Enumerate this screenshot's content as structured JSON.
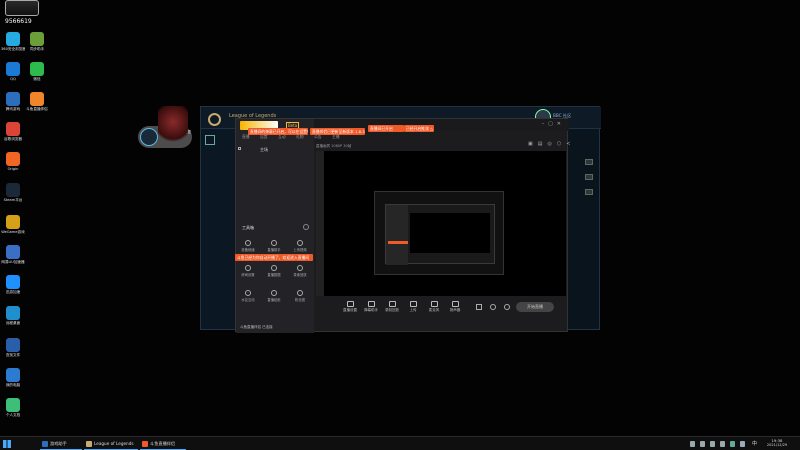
{
  "desktop": {
    "corner_widget": {
      "id": "9566619"
    },
    "icons": [
      {
        "label": "360安全浏览器",
        "color": "#27a9e1",
        "name": "360-browser-icon"
      },
      {
        "label": "同步助手",
        "color": "#6a9f3a",
        "name": "sync-assistant-icon"
      },
      {
        "label": "QQ",
        "color": "#1a7bd6",
        "name": "qq-icon"
      },
      {
        "label": "微信",
        "color": "#2dbb4e",
        "name": "wechat-icon"
      },
      {
        "label": "腾讯游戏",
        "color": "#2a6ebc",
        "name": "tencent-games-icon"
      },
      {
        "label": "斗鱼直播伴侣",
        "color": "#f0852a",
        "name": "douyu-icon"
      },
      {
        "label": "谷歌浏览器",
        "color": "#db4437",
        "name": "chrome-icon"
      },
      {
        "label": "Origin",
        "color": "#f26522",
        "name": "origin-icon"
      },
      {
        "label": "Steam平台",
        "color": "#1b2838",
        "name": "steam-icon"
      },
      {
        "label": "WeGame游戏",
        "color": "#d4a017",
        "name": "wegame-icon"
      },
      {
        "label": "网易UU加速器",
        "color": "#3b6fc5",
        "name": "uu-accelerator-icon"
      },
      {
        "label": "迅游加速",
        "color": "#1e90ff",
        "name": "xunyou-icon"
      },
      {
        "label": "远程桌面",
        "color": "#1f8fce",
        "name": "remote-desktop-icon"
      },
      {
        "label": "查找文件",
        "color": "#2a5ea8",
        "name": "file-search-icon"
      },
      {
        "label": "我的电脑",
        "color": "#2c7bd0",
        "name": "this-pc-icon"
      },
      {
        "label": "个人文档",
        "color": "#3dbf7a",
        "name": "documents-icon"
      }
    ]
  },
  "lol_client": {
    "title": "League of Legends",
    "status": "BBC 社区",
    "avatar_badge": "掌盟游戏 英雄联盟",
    "nav": [
      "社区",
      "商城",
      "个人"
    ]
  },
  "recorder": {
    "title": "直播伴侣",
    "version": "Beta",
    "notifications": [
      "直播间的弹幕已开启，可以在设置中查看具体内容",
      "直播伴侣已更新至新版本 1.8.3",
      "直播间已开启",
      "已经开启推流 △",
      "斗鱼已经为你自动开播了，欢迎进入直播间"
    ],
    "tabs": [
      "直播",
      "设置",
      "互动",
      "礼物",
      "公告",
      "主播"
    ],
    "side": {
      "scene": "主场",
      "section_title": "工具箱",
      "tools": [
        "准备就绪",
        "直播助手",
        "上传视频",
        "房间设置",
        "直播数据",
        "录像回放",
        "水友互动",
        "直播贴纸",
        "粉丝团"
      ],
      "footer": "斗鱼直播伴侣 已连接"
    },
    "preview_info": [
      "直播画质",
      "1080P 30帧",
      "码率 6000kbps",
      "FPS 60"
    ],
    "bottom_tools": [
      "直播设置",
      "弹幕助手",
      "录制回放",
      "上传",
      "麦克风",
      "扬声器"
    ],
    "start_button": "开始直播",
    "window_buttons": [
      "min",
      "max",
      "close"
    ]
  },
  "taskbar": {
    "apps": [
      {
        "label": "游戏助手",
        "color": "#2a6ebc"
      },
      {
        "label": "League of Legends",
        "color": "#c8aa6e"
      },
      {
        "label": "斗鱼直播伴侣",
        "color": "#f05a28"
      }
    ],
    "clock_time": "19:38",
    "clock_date": "2021/12/29",
    "lang": "中"
  }
}
